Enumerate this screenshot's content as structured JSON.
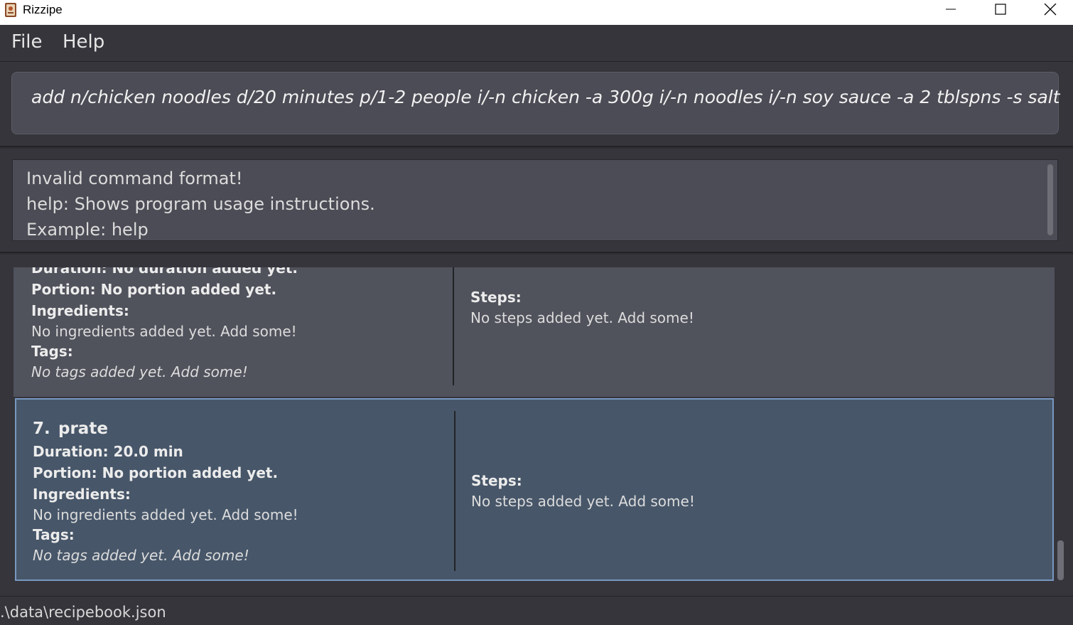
{
  "window": {
    "title": "Rizzipe"
  },
  "menu": {
    "items": [
      "File",
      "Help"
    ]
  },
  "command_box": {
    "value": "add n/chicken noodles d/20 minutes p/1-2 people i/-n chicken -a 300g i/-n noodles i/-n soy sauce -a 2 tblspns -s salt"
  },
  "result_display": {
    "lines": [
      "Invalid command format!",
      "help: Shows program usage instructions.",
      "Example: help"
    ]
  },
  "recipes": [
    {
      "duration": "Duration: No duration added yet.",
      "portion": "Portion: No portion added yet.",
      "ingredients_label": "Ingredients:",
      "ingredients": "No ingredients added yet. Add some!",
      "tags_label": "Tags:",
      "tags": "No tags added yet. Add some!",
      "steps_label": "Steps:",
      "steps": "No steps added yet. Add some!"
    },
    {
      "index": "7.",
      "name": "prate",
      "duration": "Duration: 20.0 min",
      "portion": "Portion: No portion added yet.",
      "ingredients_label": "Ingredients:",
      "ingredients": "No ingredients added yet. Add some!",
      "tags_label": "Tags:",
      "tags": "No tags added yet. Add some!",
      "steps_label": "Steps:",
      "steps": "No steps added yet. Add some!",
      "selected": true
    }
  ],
  "status_bar": {
    "path": ".\\data\\recipebook.json"
  }
}
